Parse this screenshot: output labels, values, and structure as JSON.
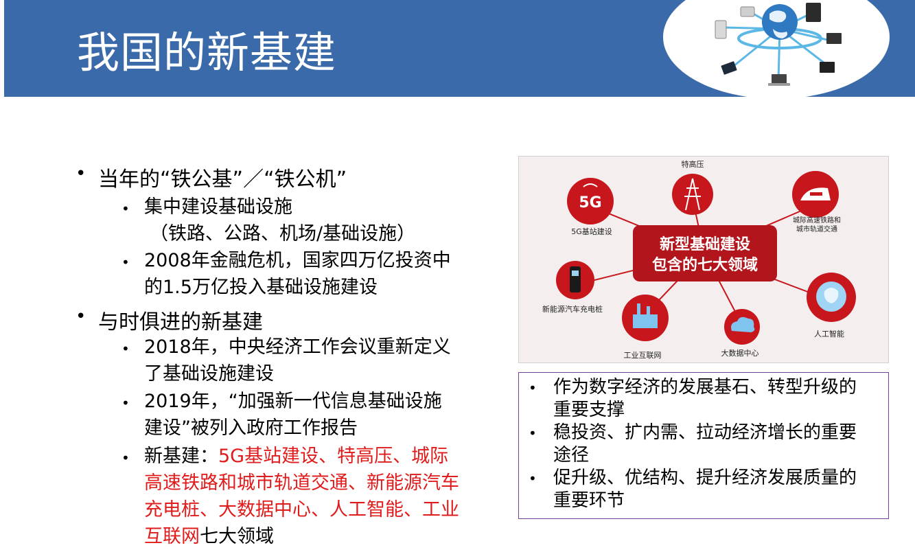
{
  "header": {
    "title": "我国的新基建",
    "image_icon": "network-globe-icon"
  },
  "content": {
    "items": [
      {
        "text": "当年的“铁公基”／“铁公机”"
      },
      {
        "text": "集中建设基础设施"
      },
      {
        "text": "（铁路、公路、机场/基础设施）"
      },
      {
        "text": "2008年金融危机，国家四万亿投资中"
      },
      {
        "text": "的1.5万亿投入基础设施建设"
      },
      {
        "text": "与时俱进的新基建"
      },
      {
        "text": "2018年，中央经济工作会议重新定义"
      },
      {
        "text": "了基础设施建设"
      },
      {
        "text": "2019年，“加强新一代信息基础设施"
      },
      {
        "text": "建设”被列入政府工作报告"
      },
      {
        "prefix": "新基建：",
        "highlight": "5G基站建设、特高压、城际"
      },
      {
        "highlight": "高速铁路和城市轨道交通、新能源汽车"
      },
      {
        "highlight": "充电桩、大数据中心、人工智能、工业"
      },
      {
        "highlight": "互联网",
        "suffix": "七大领域"
      }
    ]
  },
  "infographic": {
    "center": [
      "新型基础建设",
      "包含的七大领域"
    ],
    "nodes": [
      {
        "label": "特高压",
        "icon": "power-tower-icon"
      },
      {
        "label": "5G基站建设",
        "icon": "5g-icon"
      },
      {
        "label": "城际高速铁路和",
        "label2": "城市轨道交通",
        "icon": "train-icon"
      },
      {
        "label": "新能源汽车充电桩",
        "icon": "charging-pile-icon"
      },
      {
        "label": "工业互联网",
        "icon": "factory-icon"
      },
      {
        "label": "大数据中心",
        "icon": "cloud-data-icon"
      },
      {
        "label": "人工智能",
        "icon": "ai-head-icon"
      }
    ]
  },
  "summary": {
    "items": [
      {
        "line1": "作为数字经济的发展基石、转型升级的",
        "line2": "重要支撑"
      },
      {
        "line1": "稳投资、扩内需、拉动经济增长的重要",
        "line2": "途径"
      },
      {
        "line1": "促升级、优结构、提升经济发展质量的",
        "line2": "重要环节"
      }
    ]
  },
  "colors": {
    "header_blue": "#3a6aa9",
    "highlight_red": "#e01b1b",
    "node_red": "#c8161d",
    "box_border": "#7a3f99"
  },
  "bullet": "•"
}
